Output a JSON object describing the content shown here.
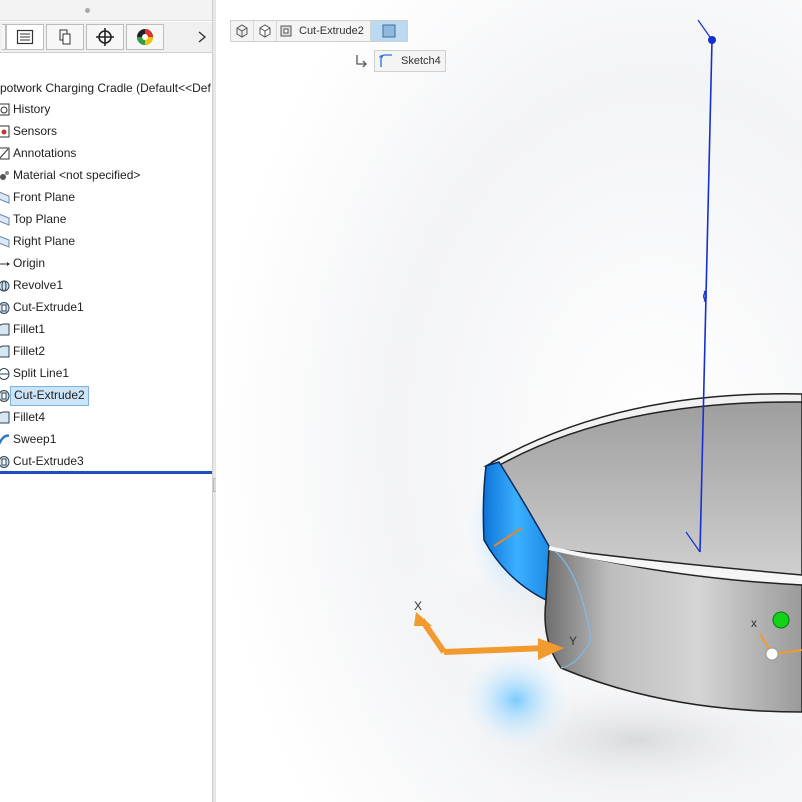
{
  "feature_tree": {
    "root_label": "potwork Charging Cradle  (Default<<Def",
    "items": [
      {
        "label": "History",
        "icon": "history-icon"
      },
      {
        "label": "Sensors",
        "icon": "sensors-icon"
      },
      {
        "label": "Annotations",
        "icon": "annotations-icon"
      },
      {
        "label": "Material <not specified>",
        "icon": "material-icon"
      },
      {
        "label": "Front Plane",
        "icon": "plane-icon"
      },
      {
        "label": "Top Plane",
        "icon": "plane-icon"
      },
      {
        "label": "Right Plane",
        "icon": "plane-icon"
      },
      {
        "label": "Origin",
        "icon": "origin-icon"
      },
      {
        "label": "Revolve1",
        "icon": "revolve-icon"
      },
      {
        "label": "Cut-Extrude1",
        "icon": "cut-extrude-icon"
      },
      {
        "label": "Fillet1",
        "icon": "fillet-icon"
      },
      {
        "label": "Fillet2",
        "icon": "fillet-icon"
      },
      {
        "label": "Split Line1",
        "icon": "split-line-icon"
      },
      {
        "label": "Cut-Extrude2",
        "icon": "cut-extrude-icon",
        "selected": true
      },
      {
        "label": "Fillet4",
        "icon": "fillet-icon"
      },
      {
        "label": "Sweep1",
        "icon": "sweep-icon"
      },
      {
        "label": "Cut-Extrude3",
        "icon": "cut-extrude-icon"
      }
    ]
  },
  "panel_tabs": [
    {
      "name": "feature-manager-tab",
      "icon": "feature-tree-icon"
    },
    {
      "name": "property-manager-tab",
      "icon": "property-manager-icon"
    },
    {
      "name": "configuration-manager-tab",
      "icon": "configuration-icon"
    },
    {
      "name": "dimxpert-tab",
      "icon": "crosshair-icon"
    },
    {
      "name": "display-manager-tab",
      "icon": "appearance-icon"
    }
  ],
  "breadcrumb": {
    "feature_label": "Cut-Extrude2",
    "sketch_label": "Sketch4"
  },
  "triad": {
    "x_label": "X",
    "y_label": "Y",
    "small_x_label": "x"
  },
  "colors": {
    "selection_blue": "#2aa3f5",
    "sketch_line": "#1530d0",
    "rollback_bar": "#1f4fbf",
    "axis_orange": "#f19a2e",
    "origin_green": "#12d21a"
  }
}
